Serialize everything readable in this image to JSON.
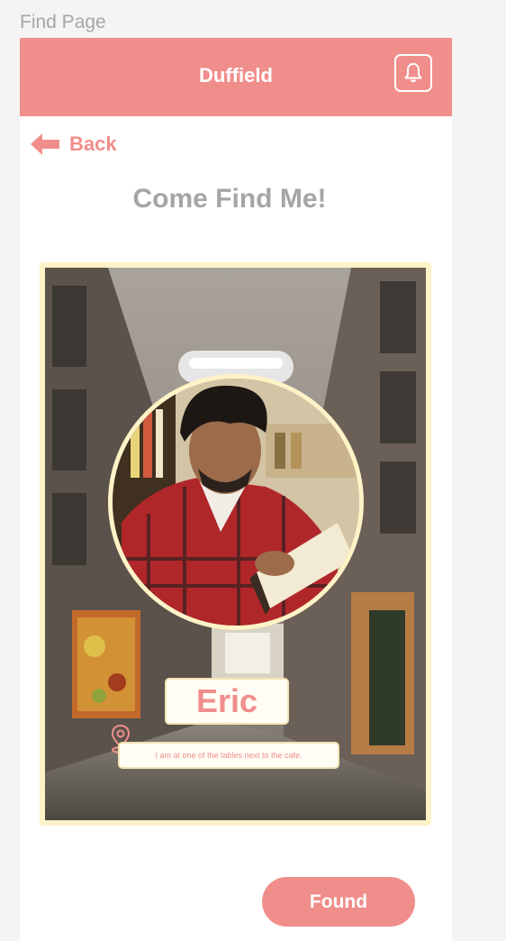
{
  "frame": {
    "label": "Find Page"
  },
  "header": {
    "title": "Duffield",
    "bell_icon": "bell-icon"
  },
  "nav": {
    "back_label": "Back",
    "back_icon": "arrow-left-icon"
  },
  "heading": "Come Find Me!",
  "card": {
    "name": "Eric",
    "location_note": "I am at one of the tables next to the cafe.",
    "pin_icon": "location-pin-icon"
  },
  "actions": {
    "found_label": "Found"
  },
  "colors": {
    "accent": "#f08e8b",
    "card_border": "#fdf3c7",
    "muted_text": "#a5a5a5"
  }
}
